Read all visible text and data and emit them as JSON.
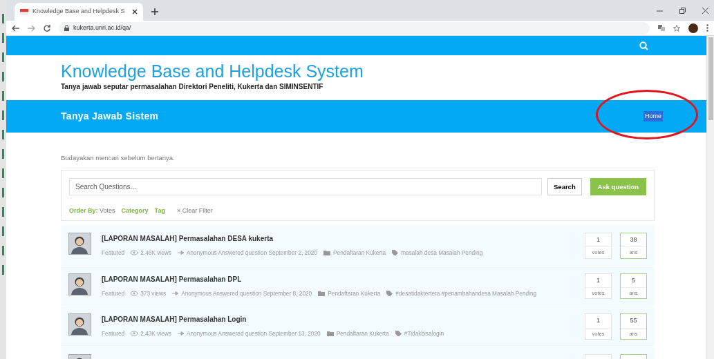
{
  "browser": {
    "tab_title": "Knowledge Base and Helpdesk S",
    "url": "kukerta.unri.ac.id/qa/"
  },
  "site": {
    "title": "Knowledge Base and Helpdesk System",
    "subtitle": "Tanya jawab seputar permasalahan Direktori Peneliti, Kukerta dan SIMINSENTIF",
    "banner_title": "Tanya Jawab Sistem",
    "nav": [
      {
        "label": "Home",
        "selected": true
      }
    ]
  },
  "annotations": [
    {
      "kind": "ellipse"
    }
  ],
  "intro": "Budayakan mencari sebelum bertanya.",
  "search": {
    "placeholder": "Search Questions...",
    "search_button": "Search",
    "ask_button": "Ask question"
  },
  "filters": {
    "order_label": "Order By:",
    "order_value": "Votes",
    "links": [
      "Category",
      "Tag"
    ],
    "clear_icon": "×",
    "clear": "Clear Filter"
  },
  "questions": [
    {
      "kind": "full",
      "title": "[LAPORAN MASALAH] Permasalahan DESA kukerta",
      "featured": "Featured",
      "views": "2.46K views",
      "activity": "Anonymous Answered question September 2, 2020",
      "category": "Pendaftaran Kukerta",
      "tags": "masalah desa Masalah Pending",
      "votes": "1",
      "votes_label": "votes",
      "answers": "38",
      "answers_label": "ans"
    },
    {
      "kind": "full",
      "title": "[LAPORAN MASALAH] Permasalahan DPL",
      "featured": "Featured",
      "views": "373 views",
      "activity": "Anonymous Answered question September 8, 2020",
      "category": "Pendaftaran Kukerta",
      "tags": "#desatidaktertera #penambahandesa Masalah Pending",
      "votes": "1",
      "votes_label": "votes",
      "answers": "5",
      "answers_label": "ans"
    },
    {
      "kind": "full",
      "title": "[LAPORAN MASALAH] Permasalahan Login",
      "featured": "Featured",
      "views": "2.43K views",
      "activity": "Anonymous Answered question September 13, 2020",
      "category": "Pendaftaran Kukerta",
      "tags": "#Tidakbisalogin",
      "votes": "1",
      "votes_label": "votes",
      "answers": "55",
      "answers_label": "ans"
    },
    {
      "kind": "cut_off"
    }
  ]
}
